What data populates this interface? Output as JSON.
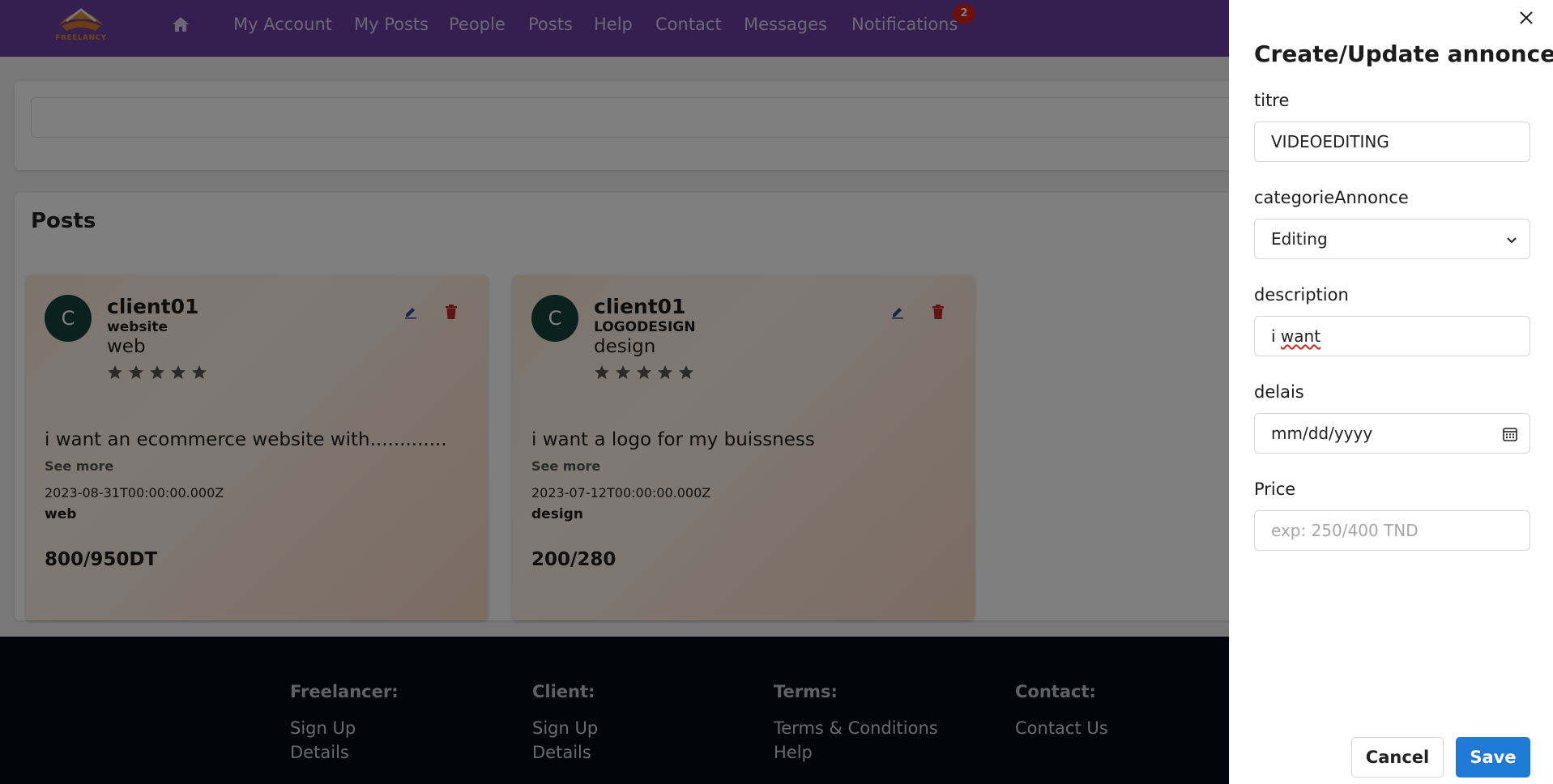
{
  "nav": {
    "logo_text": "FREELANCY",
    "links": [
      "My Account",
      "My Posts",
      "People",
      "Posts",
      "Help",
      "Contact",
      "Messages",
      "Notifications"
    ],
    "notification_count": "2"
  },
  "posts_section": {
    "title": "Posts",
    "cards": [
      {
        "avatar_letter": "C",
        "client": "client01",
        "title": "website",
        "category": "web",
        "rating_stars": 5,
        "description": "i want an ecommerce website with.............",
        "see_more": "See more",
        "date": "2023-08-31T00:00:00.000Z",
        "tag": "web",
        "price": "800/950DT"
      },
      {
        "avatar_letter": "C",
        "client": "client01",
        "title": "LOGODESIGN",
        "category": "design",
        "rating_stars": 5,
        "description": "i want a logo for my buissness",
        "see_more": "See more",
        "date": "2023-07-12T00:00:00.000Z",
        "tag": "design",
        "price": "200/280"
      }
    ]
  },
  "footer": {
    "columns": [
      {
        "heading": "Freelancer:",
        "links": [
          "Sign Up",
          "Details"
        ]
      },
      {
        "heading": "Client:",
        "links": [
          "Sign Up",
          "Details"
        ]
      },
      {
        "heading": "Terms:",
        "links": [
          "Terms & Conditions",
          "Help"
        ]
      },
      {
        "heading": "Contact:",
        "links": [
          "Contact Us"
        ]
      }
    ]
  },
  "drawer": {
    "title": "Create/Update annonce",
    "titre_label": "titre",
    "titre_value": "VIDEOEDITING",
    "categorie_label": "categorieAnnonce",
    "categorie_value": "Editing",
    "description_label": "description",
    "description_prefix": "i ",
    "description_misspelled": "want",
    "delais_label": "delais",
    "delais_placeholder": "mm/dd/yyyy",
    "price_label": "Price",
    "price_placeholder": "exp: 250/400 TND",
    "cancel_label": "Cancel",
    "save_label": "Save"
  },
  "colors": {
    "nav_bg": "#6b3fa0",
    "footer_bg": "#060b18",
    "save_button": "#1f7ad6",
    "badge": "#d61f1f",
    "avatar": "#14433a",
    "delete_icon": "#c0282d",
    "edit_icon": "#2a4a9a"
  }
}
